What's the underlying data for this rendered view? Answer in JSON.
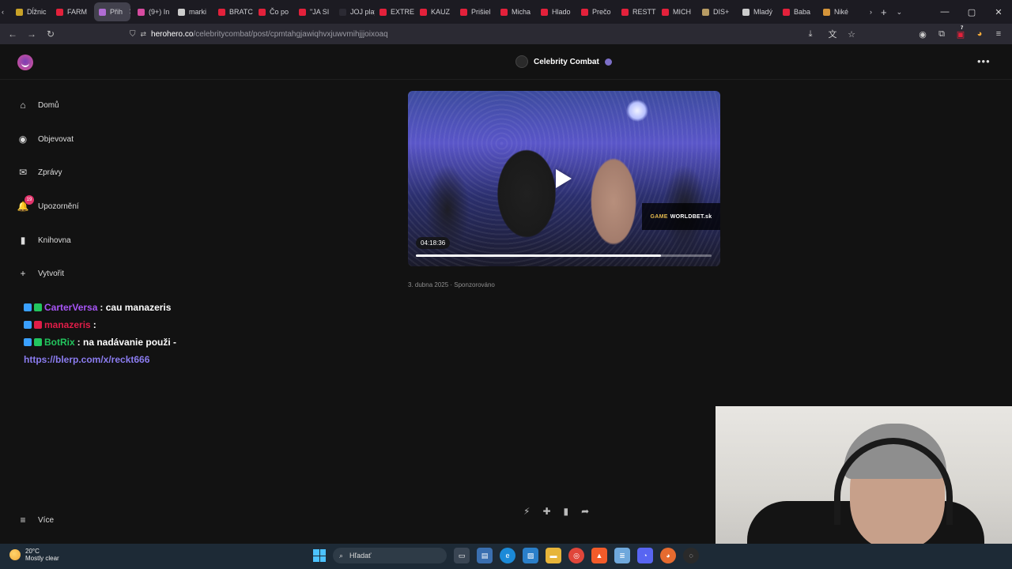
{
  "browser": {
    "tabs": [
      {
        "label": "Dĺžnic",
        "color": "#c9a227"
      },
      {
        "label": "FARM",
        "color": "#e3213b"
      },
      {
        "label": "Přih",
        "color": "#b06cd3",
        "active": true
      },
      {
        "label": "(9+) In",
        "color": "#d64ba0"
      },
      {
        "label": "marki",
        "color": "#cccccc"
      },
      {
        "label": "BRATC",
        "color": "#e3213b"
      },
      {
        "label": "Čo po",
        "color": "#e3213b"
      },
      {
        "label": "\"JA SI",
        "color": "#e3213b"
      },
      {
        "label": "JOJ play",
        "color": "#2b2a33"
      },
      {
        "label": "EXTRE",
        "color": "#e3213b"
      },
      {
        "label": "KAUZ",
        "color": "#e3213b"
      },
      {
        "label": "Prišiel",
        "color": "#e3213b"
      },
      {
        "label": "Micha",
        "color": "#e3213b"
      },
      {
        "label": "Hlado",
        "color": "#e3213b"
      },
      {
        "label": "Prečo",
        "color": "#e3213b"
      },
      {
        "label": "RESTT",
        "color": "#e3213b"
      },
      {
        "label": "MICH",
        "color": "#e3213b"
      },
      {
        "label": "DIS+",
        "color": "#b79b63"
      },
      {
        "label": "Mladý",
        "color": "#cccccc"
      },
      {
        "label": "Baba",
        "color": "#e3213b"
      },
      {
        "label": "Niké",
        "color": "#d4943a"
      }
    ],
    "new_tab": "+",
    "tab_list": "⌄",
    "url_host": "herohero.co",
    "url_path": "/celebritycombat/post/cpmtahgjawiqhvxjuwvmihjjjoixoaq",
    "extensions_badge": "7"
  },
  "header": {
    "creator_name": "Celebrity Combat",
    "more": "•••"
  },
  "sidebar": {
    "items": [
      {
        "label": "Domů",
        "icon": "home-icon",
        "glyph": "⌂"
      },
      {
        "label": "Objevovat",
        "icon": "compass-icon",
        "glyph": "◉"
      },
      {
        "label": "Zprávy",
        "icon": "mail-icon",
        "glyph": "✉"
      },
      {
        "label": "Upozornění",
        "icon": "bell-icon",
        "glyph": "🔔",
        "badge": "19"
      },
      {
        "label": "Knihovna",
        "icon": "bookmark-icon",
        "glyph": "▮"
      },
      {
        "label": "Vytvořit",
        "icon": "plus-icon",
        "glyph": "+"
      }
    ],
    "more_label": "Více"
  },
  "post": {
    "duration": "04:18:36",
    "progress": 0.83,
    "sponsor_prefix": "GAME",
    "sponsor_rest": "WORLDBET.sk",
    "meta": "3. dubna 2025 · Sponzorováno"
  },
  "chat": [
    {
      "user": "CarterVersa",
      "user_color": "#a855f7",
      "message": " : cau manazeris"
    },
    {
      "user": "manazeris",
      "user_color": "#e11d48",
      "message": " :"
    },
    {
      "user": "BotRix",
      "user_color": "#22c55e",
      "message": " : na nadávanie použi -"
    }
  ],
  "chat_link": "https://blerp.com/x/reckt666",
  "taskbar": {
    "temp": "20°C",
    "condition": "Mostly clear",
    "search_label": "Hľadať"
  }
}
